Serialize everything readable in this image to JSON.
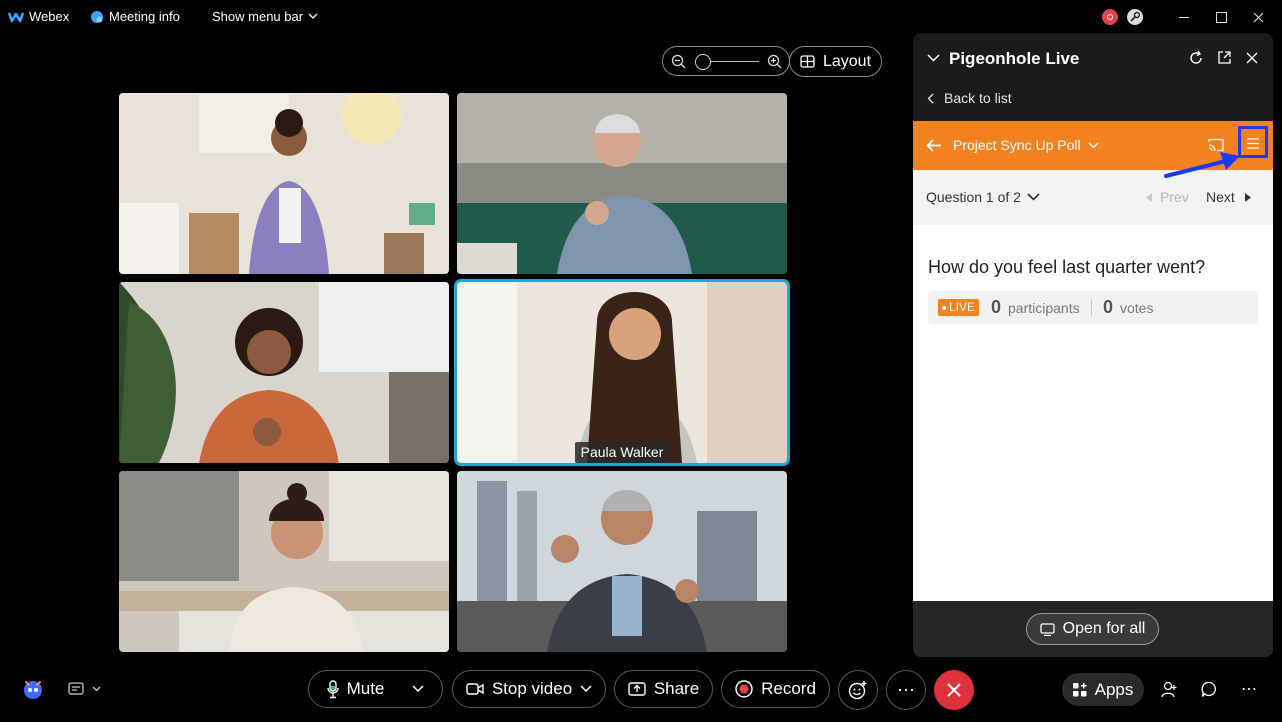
{
  "topbar": {
    "app_name": "Webex",
    "meeting_info": "Meeting info",
    "show_menu_bar": "Show menu bar"
  },
  "toolbar": {
    "layout_label": "Layout"
  },
  "participants": [
    {
      "name": ""
    },
    {
      "name": ""
    },
    {
      "name": ""
    },
    {
      "name": "Paula Walker",
      "active": true
    },
    {
      "name": ""
    },
    {
      "name": ""
    }
  ],
  "panel": {
    "title": "Pigeonhole Live",
    "back_label": "Back to list",
    "poll_title": "Project Sync Up Poll",
    "question_counter": "Question 1 of 2",
    "prev_label": "Prev",
    "next_label": "Next",
    "question_text": "How do you feel last quarter went?",
    "live_badge": "LIVE",
    "participants_count": "0",
    "participants_label": "participants",
    "votes_count": "0",
    "votes_label": "votes",
    "open_for_all": "Open for all"
  },
  "controls": {
    "mute": "Mute",
    "stop_video": "Stop video",
    "share": "Share",
    "record": "Record",
    "apps": "Apps"
  },
  "colors": {
    "accent_orange": "#f2821f",
    "active_speaker": "#22a7d0",
    "end_call": "#e0323c",
    "highlight_box": "#1a3bff"
  }
}
